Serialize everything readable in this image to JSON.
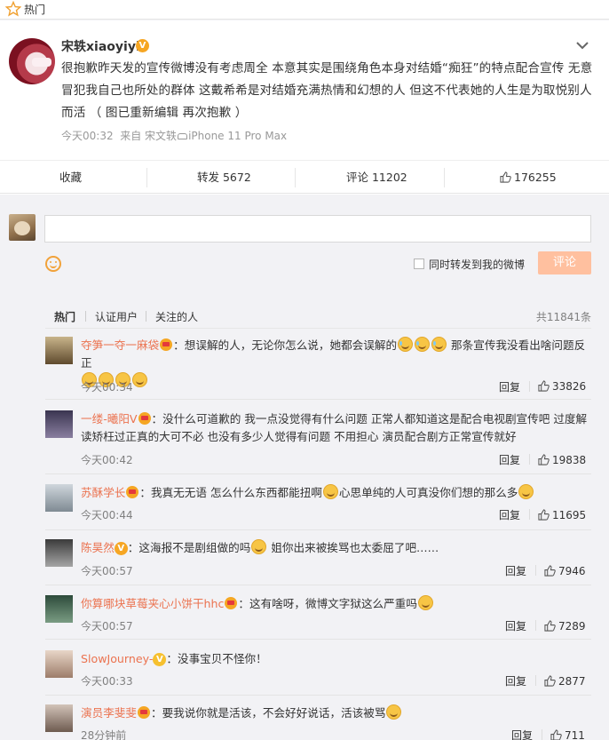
{
  "topbar": {
    "title": "热门"
  },
  "post": {
    "username": "宋轶xiaoyiyi",
    "verified": "V",
    "text": "很抱歉昨天发的宣传微博没有考虑周全 本意其实是围绕角色本身对结婚“痴狂”的特点配合宣传 无意冒犯我自己也所处的群体 这戴希希是对结婚充满热情和幻想的人 但这不代表她的人生是为取悦别人而活 （ 图已重新编辑 再次抱歉 ）",
    "time": "今天00:32",
    "source_prefix": "来自 宋文轶",
    "source_device": "iPhone 11 Pro Max",
    "actions": {
      "favorite": "收藏",
      "repost": "转发 5672",
      "comment": "评论 11202",
      "likes": "176255"
    }
  },
  "composer": {
    "forward_label": "同时转发到我的微博",
    "submit": "评论"
  },
  "filters": {
    "hot": "热门",
    "verified": "认证用户",
    "following": "关注的人",
    "total": "共11841条"
  },
  "comments": [
    {
      "name": "夺笋一夺一麻袋",
      "pre": "：想误解的人，无论你怎么说，她都会误解的",
      "mid": "那条宣传我没看出啥问题反正",
      "time": "今天00:34",
      "reply": "回复",
      "likes": "33826"
    },
    {
      "name": "一缕-曦阳V",
      "text": "：没什么可道歉的 我一点没觉得有什么问题 正常人都知道这是配合电视剧宣传吧 过度解读矫枉过正真的大可不必 也没有多少人觉得有问题 不用担心 演员配合剧方正常宣传就好",
      "time": "今天00:42",
      "reply": "回复",
      "likes": "19838"
    },
    {
      "name": "苏酥学长",
      "pre": "：我真无无语 怎么什么东西都能扭啊",
      "mid": "心思单纯的人可真没你们想的那么多",
      "time": "今天00:44",
      "reply": "回复",
      "likes": "11695"
    },
    {
      "name": "陈昊然",
      "pre": "：这海报不是剧组做的吗",
      "mid": "姐你出来被挨骂也太委屈了吧……",
      "time": "今天00:57",
      "reply": "回复",
      "likes": "7946"
    },
    {
      "name": "你算哪块草莓夹心小饼干hhc",
      "pre": "：这有啥呀，微博文字狱这么严重吗",
      "time": "今天00:57",
      "reply": "回复",
      "likes": "7289"
    },
    {
      "name": "SlowJourney-",
      "pre": "：没事宝贝不怪你！",
      "time": "今天00:33",
      "reply": "回复",
      "likes": "2877"
    },
    {
      "name": "演员李斐斐",
      "pre": "：要我说你就是活该，不会好好说话，活该被骂",
      "time": "28分钟前",
      "reply": "回复",
      "likes": "711"
    }
  ],
  "colors": {
    "accent": "#eb7350",
    "name_blue": "#eb7350",
    "submit_disabled": "#ffc09f"
  }
}
